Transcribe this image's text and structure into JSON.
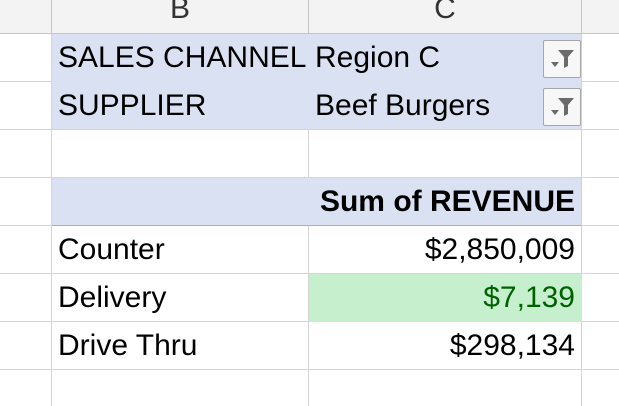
{
  "columns": [
    {
      "letter": "B"
    },
    {
      "letter": "C"
    }
  ],
  "filters": [
    {
      "field": "SALES CHANNEL",
      "value": "Region C",
      "icon": "filter-dropdown-icon"
    },
    {
      "field": "SUPPLIER",
      "value": "Beef Burgers",
      "icon": "filter-dropdown-icon"
    }
  ],
  "pivot": {
    "value_header": "Sum of REVENUE",
    "rows": [
      {
        "label": "Counter",
        "value": "$2,850,009"
      },
      {
        "label": "Delivery",
        "value": "$7,139"
      },
      {
        "label": "Drive Thru",
        "value": "$298,134"
      }
    ]
  },
  "colors": {
    "filter_band": "#d9e1f2",
    "highlight_fill": "#c6efce",
    "highlight_text": "#006100"
  }
}
